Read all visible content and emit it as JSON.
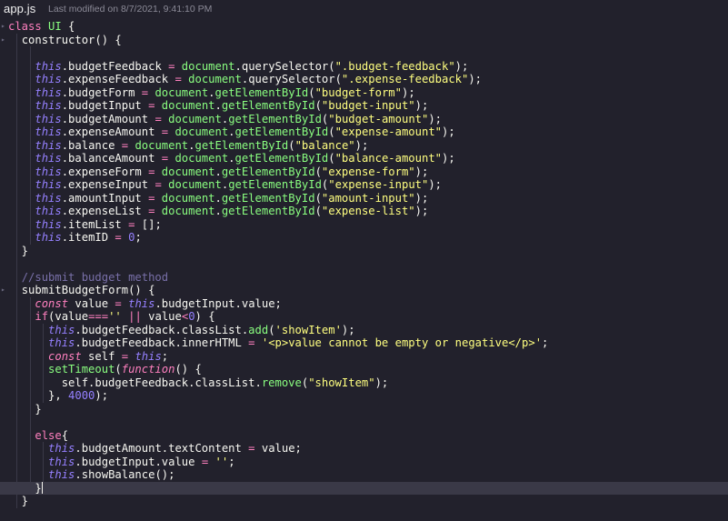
{
  "tab": {
    "filename": "app.js"
  },
  "status": {
    "last_modified": "Last modified on 8/7/2021, 9:41:10 PM"
  },
  "colors": {
    "background": "#22212c",
    "keyword": "#ff80bf",
    "function": "#8aff80",
    "this": "#9580ff",
    "string": "#ffff80",
    "comment": "#7970a9"
  },
  "code": {
    "lines": [
      {
        "segments": [
          {
            "text": "class ",
            "cls": "kw"
          },
          {
            "text": "UI",
            "cls": "cls"
          },
          {
            "text": " {",
            "cls": "prop"
          }
        ]
      },
      {
        "segments": [
          {
            "text": "  "
          },
          {
            "text": "constructor",
            "cls": "prop"
          },
          {
            "text": "() {",
            "cls": "prop"
          }
        ]
      },
      {
        "segments": [
          {
            "text": ""
          }
        ]
      },
      {
        "segments": [
          {
            "text": "    "
          },
          {
            "text": "this",
            "cls": "this"
          },
          {
            "text": ".budgetFeedback "
          },
          {
            "text": "=",
            "cls": "op"
          },
          {
            "text": " document",
            "cls": "fn"
          },
          {
            "text": ".querySelector("
          },
          {
            "text": "\".budget-feedback\"",
            "cls": "str"
          },
          {
            "text": ");"
          }
        ]
      },
      {
        "segments": [
          {
            "text": "    "
          },
          {
            "text": "this",
            "cls": "this"
          },
          {
            "text": ".expenseFeedback "
          },
          {
            "text": "=",
            "cls": "op"
          },
          {
            "text": " document",
            "cls": "fn"
          },
          {
            "text": ".querySelector("
          },
          {
            "text": "\".expense-feedback\"",
            "cls": "str"
          },
          {
            "text": ");"
          }
        ]
      },
      {
        "segments": [
          {
            "text": "    "
          },
          {
            "text": "this",
            "cls": "this"
          },
          {
            "text": ".budgetForm "
          },
          {
            "text": "=",
            "cls": "op"
          },
          {
            "text": " document",
            "cls": "fn"
          },
          {
            "text": "."
          },
          {
            "text": "getElementById",
            "cls": "fn"
          },
          {
            "text": "("
          },
          {
            "text": "\"budget-form\"",
            "cls": "str"
          },
          {
            "text": ");"
          }
        ]
      },
      {
        "segments": [
          {
            "text": "    "
          },
          {
            "text": "this",
            "cls": "this"
          },
          {
            "text": ".budgetInput "
          },
          {
            "text": "=",
            "cls": "op"
          },
          {
            "text": " document",
            "cls": "fn"
          },
          {
            "text": "."
          },
          {
            "text": "getElementById",
            "cls": "fn"
          },
          {
            "text": "("
          },
          {
            "text": "\"budget-input\"",
            "cls": "str"
          },
          {
            "text": ");"
          }
        ]
      },
      {
        "segments": [
          {
            "text": "    "
          },
          {
            "text": "this",
            "cls": "this"
          },
          {
            "text": ".budgetAmount "
          },
          {
            "text": "=",
            "cls": "op"
          },
          {
            "text": " document",
            "cls": "fn"
          },
          {
            "text": "."
          },
          {
            "text": "getElementById",
            "cls": "fn"
          },
          {
            "text": "("
          },
          {
            "text": "\"budget-amount\"",
            "cls": "str"
          },
          {
            "text": ");"
          }
        ]
      },
      {
        "segments": [
          {
            "text": "    "
          },
          {
            "text": "this",
            "cls": "this"
          },
          {
            "text": ".expenseAmount "
          },
          {
            "text": "=",
            "cls": "op"
          },
          {
            "text": " document",
            "cls": "fn"
          },
          {
            "text": "."
          },
          {
            "text": "getElementById",
            "cls": "fn"
          },
          {
            "text": "("
          },
          {
            "text": "\"expense-amount\"",
            "cls": "str"
          },
          {
            "text": ");"
          }
        ]
      },
      {
        "segments": [
          {
            "text": "    "
          },
          {
            "text": "this",
            "cls": "this"
          },
          {
            "text": ".balance "
          },
          {
            "text": "=",
            "cls": "op"
          },
          {
            "text": " document",
            "cls": "fn"
          },
          {
            "text": "."
          },
          {
            "text": "getElementById",
            "cls": "fn"
          },
          {
            "text": "("
          },
          {
            "text": "\"balance\"",
            "cls": "str"
          },
          {
            "text": ");"
          }
        ]
      },
      {
        "segments": [
          {
            "text": "    "
          },
          {
            "text": "this",
            "cls": "this"
          },
          {
            "text": ".balanceAmount "
          },
          {
            "text": "=",
            "cls": "op"
          },
          {
            "text": " document",
            "cls": "fn"
          },
          {
            "text": "."
          },
          {
            "text": "getElementById",
            "cls": "fn"
          },
          {
            "text": "("
          },
          {
            "text": "\"balance-amount\"",
            "cls": "str"
          },
          {
            "text": ");"
          }
        ]
      },
      {
        "segments": [
          {
            "text": "    "
          },
          {
            "text": "this",
            "cls": "this"
          },
          {
            "text": ".expenseForm "
          },
          {
            "text": "=",
            "cls": "op"
          },
          {
            "text": " document",
            "cls": "fn"
          },
          {
            "text": "."
          },
          {
            "text": "getElementById",
            "cls": "fn"
          },
          {
            "text": "("
          },
          {
            "text": "\"expense-form\"",
            "cls": "str"
          },
          {
            "text": ");"
          }
        ]
      },
      {
        "segments": [
          {
            "text": "    "
          },
          {
            "text": "this",
            "cls": "this"
          },
          {
            "text": ".expenseInput "
          },
          {
            "text": "=",
            "cls": "op"
          },
          {
            "text": " document",
            "cls": "fn"
          },
          {
            "text": "."
          },
          {
            "text": "getElementById",
            "cls": "fn"
          },
          {
            "text": "("
          },
          {
            "text": "\"expense-input\"",
            "cls": "str"
          },
          {
            "text": ");"
          }
        ]
      },
      {
        "segments": [
          {
            "text": "    "
          },
          {
            "text": "this",
            "cls": "this"
          },
          {
            "text": ".amountInput "
          },
          {
            "text": "=",
            "cls": "op"
          },
          {
            "text": " document",
            "cls": "fn"
          },
          {
            "text": "."
          },
          {
            "text": "getElementById",
            "cls": "fn"
          },
          {
            "text": "("
          },
          {
            "text": "\"amount-input\"",
            "cls": "str"
          },
          {
            "text": ");"
          }
        ]
      },
      {
        "segments": [
          {
            "text": "    "
          },
          {
            "text": "this",
            "cls": "this"
          },
          {
            "text": ".expenseList "
          },
          {
            "text": "=",
            "cls": "op"
          },
          {
            "text": " document",
            "cls": "fn"
          },
          {
            "text": "."
          },
          {
            "text": "getElementById",
            "cls": "fn"
          },
          {
            "text": "("
          },
          {
            "text": "\"expense-list\"",
            "cls": "str"
          },
          {
            "text": ");"
          }
        ]
      },
      {
        "segments": [
          {
            "text": "    "
          },
          {
            "text": "this",
            "cls": "this"
          },
          {
            "text": ".itemList "
          },
          {
            "text": "=",
            "cls": "op"
          },
          {
            "text": " [];"
          }
        ]
      },
      {
        "segments": [
          {
            "text": "    "
          },
          {
            "text": "this",
            "cls": "this"
          },
          {
            "text": ".itemID "
          },
          {
            "text": "=",
            "cls": "op"
          },
          {
            "text": " "
          },
          {
            "text": "0",
            "cls": "num"
          },
          {
            "text": ";"
          }
        ]
      },
      {
        "segments": [
          {
            "text": "  }"
          }
        ]
      },
      {
        "segments": [
          {
            "text": ""
          }
        ]
      },
      {
        "segments": [
          {
            "text": "  "
          },
          {
            "text": "//submit budget method",
            "cls": "cm"
          }
        ]
      },
      {
        "segments": [
          {
            "text": "  "
          },
          {
            "text": "submitBudgetForm",
            "cls": "prop"
          },
          {
            "text": "() {"
          }
        ]
      },
      {
        "segments": [
          {
            "text": "    "
          },
          {
            "text": "const",
            "cls": "kwi"
          },
          {
            "text": " value "
          },
          {
            "text": "=",
            "cls": "op"
          },
          {
            "text": " "
          },
          {
            "text": "this",
            "cls": "this"
          },
          {
            "text": ".budgetInput.value;"
          }
        ]
      },
      {
        "segments": [
          {
            "text": "    "
          },
          {
            "text": "if",
            "cls": "kw"
          },
          {
            "text": "(value"
          },
          {
            "text": "===",
            "cls": "op"
          },
          {
            "text": "''",
            "cls": "str"
          },
          {
            "text": " "
          },
          {
            "text": "||",
            "cls": "op"
          },
          {
            "text": " value"
          },
          {
            "text": "<",
            "cls": "op"
          },
          {
            "text": "0",
            "cls": "num"
          },
          {
            "text": ") {"
          }
        ]
      },
      {
        "segments": [
          {
            "text": "      "
          },
          {
            "text": "this",
            "cls": "this"
          },
          {
            "text": ".budgetFeedback.classList."
          },
          {
            "text": "add",
            "cls": "fn"
          },
          {
            "text": "("
          },
          {
            "text": "'showItem'",
            "cls": "str"
          },
          {
            "text": ");"
          }
        ]
      },
      {
        "segments": [
          {
            "text": "      "
          },
          {
            "text": "this",
            "cls": "this"
          },
          {
            "text": ".budgetFeedback.innerHTML "
          },
          {
            "text": "=",
            "cls": "op"
          },
          {
            "text": " "
          },
          {
            "text": "'<p>value cannot be empty or negative</p>'",
            "cls": "str"
          },
          {
            "text": ";"
          }
        ]
      },
      {
        "segments": [
          {
            "text": "      "
          },
          {
            "text": "const",
            "cls": "kwi"
          },
          {
            "text": " self "
          },
          {
            "text": "=",
            "cls": "op"
          },
          {
            "text": " "
          },
          {
            "text": "this",
            "cls": "this"
          },
          {
            "text": ";"
          }
        ]
      },
      {
        "segments": [
          {
            "text": "      "
          },
          {
            "text": "setTimeout",
            "cls": "fn"
          },
          {
            "text": "("
          },
          {
            "text": "function",
            "cls": "kwi"
          },
          {
            "text": "() {"
          }
        ]
      },
      {
        "segments": [
          {
            "text": "        self.budgetFeedback.classList."
          },
          {
            "text": "remove",
            "cls": "fn"
          },
          {
            "text": "("
          },
          {
            "text": "\"showItem\"",
            "cls": "str"
          },
          {
            "text": ");"
          }
        ]
      },
      {
        "segments": [
          {
            "text": "      }, "
          },
          {
            "text": "4000",
            "cls": "num"
          },
          {
            "text": ");"
          }
        ]
      },
      {
        "segments": [
          {
            "text": "    }"
          }
        ]
      },
      {
        "segments": [
          {
            "text": ""
          }
        ]
      },
      {
        "segments": [
          {
            "text": "    "
          },
          {
            "text": "else",
            "cls": "kw"
          },
          {
            "text": "{"
          }
        ]
      },
      {
        "segments": [
          {
            "text": "      "
          },
          {
            "text": "this",
            "cls": "this"
          },
          {
            "text": ".budgetAmount.textContent "
          },
          {
            "text": "=",
            "cls": "op"
          },
          {
            "text": " value;"
          }
        ]
      },
      {
        "segments": [
          {
            "text": "      "
          },
          {
            "text": "this",
            "cls": "this"
          },
          {
            "text": ".budgetInput.value "
          },
          {
            "text": "=",
            "cls": "op"
          },
          {
            "text": " "
          },
          {
            "text": "''",
            "cls": "str"
          },
          {
            "text": ";"
          }
        ]
      },
      {
        "segments": [
          {
            "text": "      "
          },
          {
            "text": "this",
            "cls": "this"
          },
          {
            "text": ".showBalance();"
          }
        ]
      },
      {
        "segments": [
          {
            "text": "    }"
          }
        ],
        "active": true
      },
      {
        "segments": [
          {
            "text": "  }"
          }
        ]
      }
    ]
  }
}
